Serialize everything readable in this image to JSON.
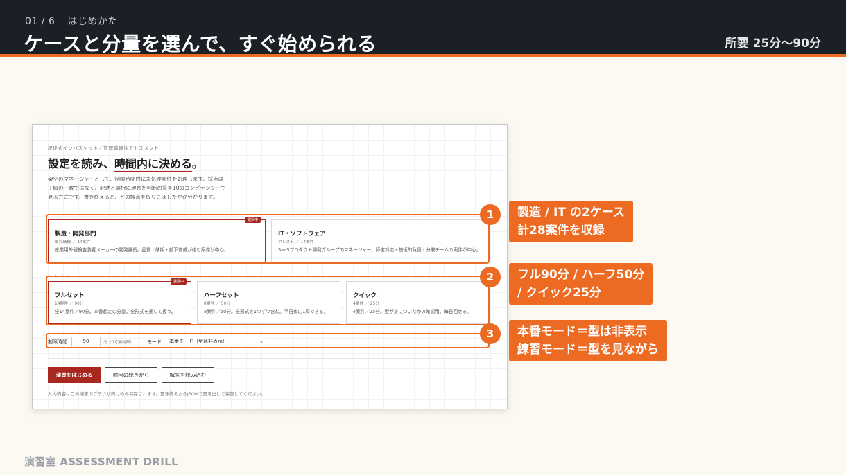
{
  "header": {
    "step_current": "01",
    "step_total": "6",
    "step_label": "はじめかた",
    "title": "ケースと分量を選んで、すぐ始められる",
    "duration": "所要 25分〜90分"
  },
  "app": {
    "eyebrow": "記述式インバスケット／管理職適性アセスメント",
    "headline_pre": "設定を読み、",
    "headline_hl": "時間内に決める",
    "headline_post": "。",
    "lead_lines": [
      "架空のマネージャーとして、制限時間内に未処理案件を処理します。採点は",
      "正解の一致ではなく、記述と選択に現れた判断の質を10のコンピテンシーで",
      "見る方式です。書き終えると、どの観点を取りこぼしたかが分かります。"
    ],
    "selected_badge": "選択中",
    "cases": [
      {
        "title": "製造・開発部門",
        "meta": "東和精機 ／ 14案件",
        "desc": "産業用外観検査装置メーカーの開発課長。品質・納期・部下育成が絡む案件が中心。",
        "selected": true
      },
      {
        "title": "IT・ソフトウェア",
        "meta": "クレスト ／ 14案件",
        "desc": "SaaSプロダクト開発グループのマネージャー。障害対応・技術的負債・分散チームの案件が中心。",
        "selected": false
      }
    ],
    "volumes": [
      {
        "title": "フルセット",
        "meta": "14案件 ／ 90分",
        "desc": "全14案件／90分。本番想定の分量。全形式を通して扱う。",
        "selected": true
      },
      {
        "title": "ハーフセット",
        "meta": "8案件 ／ 50分",
        "desc": "8案件／50分。全形式を1つずつ含む。平日夜に1周できる。",
        "selected": false
      },
      {
        "title": "クイック",
        "meta": "4案件 ／ 25分",
        "desc": "4案件／25分。型が身についたかの確認用。毎日回せる。",
        "selected": false
      }
    ],
    "settings": {
      "time_label": "制限時間",
      "minutes_value": "90",
      "minutes_suffix": "分（0で無制限）",
      "mode_label": "モード",
      "mode_value": "本番モード（型は非表示）"
    },
    "buttons": {
      "start": "演習をはじめる",
      "resume": "前回の続きから",
      "load": "解答を読み込む"
    },
    "footnote": "入力内容はこの端末のブラウザ内にのみ保存されます。書き終えたらJSONで書き出して保管してください。"
  },
  "callouts": [
    {
      "number": "1",
      "lines": [
        "製造 / IT の2ケース",
        "計28案件を収録"
      ]
    },
    {
      "number": "2",
      "lines": [
        "フル90分 / ハーフ50分",
        "/ クイック25分"
      ]
    },
    {
      "number": "3",
      "lines": [
        "本番モード＝型は非表示",
        "練習モード＝型を見ながら"
      ]
    }
  ],
  "footer": {
    "brand": "演習室 ASSESSMENT DRILL"
  },
  "colors": {
    "header_bg": "#1b1f26",
    "accent": "#ec6a22",
    "brand_red": "#a8281f",
    "page_bg": "#fbf9f1"
  }
}
